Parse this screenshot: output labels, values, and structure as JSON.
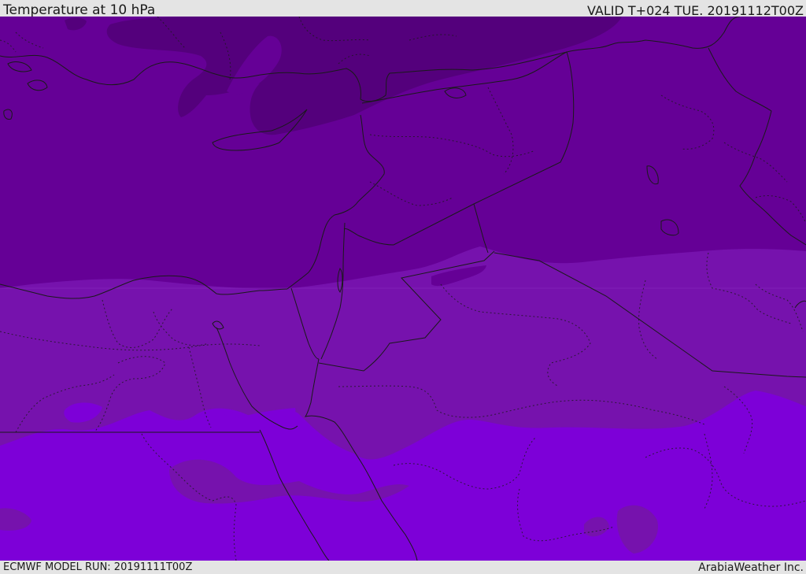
{
  "header": {
    "title": "Temperature at 10 hPa",
    "valid": "VALID T+024 TUE. 20191112T00Z"
  },
  "footer": {
    "model_run": "ECMWF MODEL RUN: 20191111T00Z",
    "credit": "ArabiaWeather Inc."
  },
  "map": {
    "field": "temperature",
    "pressure_level": "10 hPa",
    "colors": {
      "darkest": "#54007c",
      "dark": "#650096",
      "mid": "#7612ad",
      "light": "#7d00d8",
      "borders": "#1a1a1a"
    },
    "bands": [
      "darkest",
      "dark",
      "mid",
      "light"
    ]
  }
}
